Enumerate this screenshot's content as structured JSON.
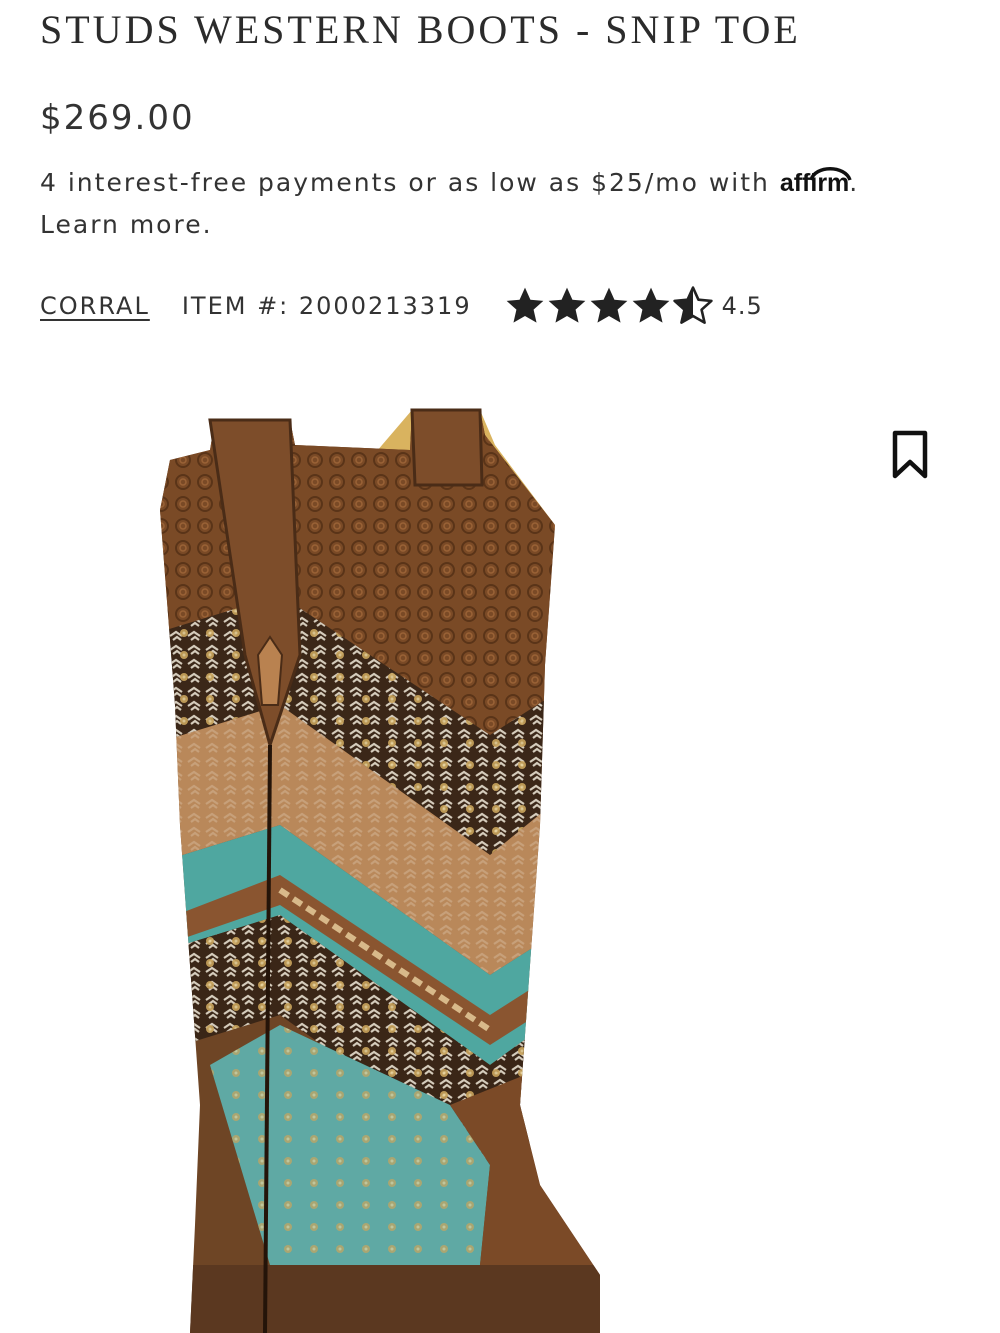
{
  "product": {
    "title": "STUDS WESTERN BOOTS - SNIP TOE",
    "price": "$269.00",
    "financing": {
      "text": "4 interest-free payments or as low as $25/mo with",
      "provider": "affirm",
      "suffix": ".",
      "learn_more": "Learn more."
    },
    "brand": "CORRAL",
    "item_number": "ITEM #: 2000213319",
    "rating": {
      "value": "4.5",
      "stars": 4.5,
      "max": 5
    }
  },
  "icons": {
    "bookmark": "bookmark-icon",
    "star": "star-icon"
  },
  "colors": {
    "text": "#333333",
    "star": "#222222"
  }
}
